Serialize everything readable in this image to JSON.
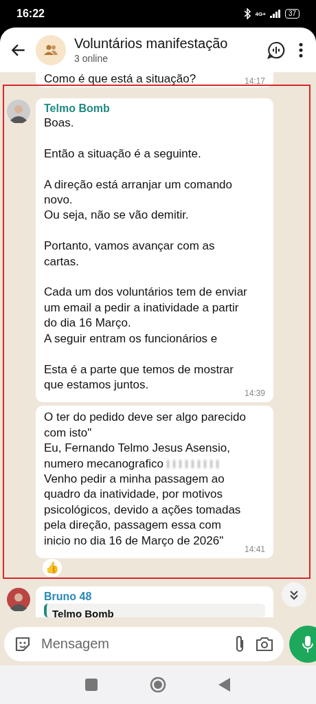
{
  "status_bar": {
    "time": "16:22",
    "network": "4G+",
    "battery": "37"
  },
  "header": {
    "title": "Voluntários manifestação",
    "subtitle": "3 online"
  },
  "messages": [
    {
      "kind": "partial",
      "text": "Como é que está a  situação?",
      "time": "14:17"
    },
    {
      "kind": "incoming",
      "sender": "Telmo Bomb",
      "segments": [
        {
          "kind": "text",
          "text": "Boas.\n\nEntão a situação é a seguinte.\n\nA direção está arranjar um comando novo.\nOu seja, não se vão demitir.\n\nPortanto, vamos avançar com as cartas.\n\nCada um dos voluntários tem de enviar um email a pedir a inatividade a partir do dia 16 Março.\nA seguir entram os funcionários e\n\nEsta é a parte que temos de mostrar que estamos juntos."
        }
      ],
      "time": "14:39"
    },
    {
      "kind": "continuation",
      "segments": [
        {
          "kind": "text",
          "text": "O ter do pedido deve ser algo parecido com isto\"\nEu, Fernando Telmo Jesus Asensio, numero mecanografico "
        },
        {
          "kind": "redacted"
        },
        {
          "kind": "text",
          "text": "\nVenho pedir a minha passagem ao quadro da inatividade, por motivos psicológicos, devido a ações tomadas pela direção, passagem essa com inicio no dia 16 de Março de 2026\""
        }
      ],
      "time": "14:41",
      "reaction": "👍"
    },
    {
      "kind": "incoming_cut",
      "sender": "Bruno 48",
      "quote_sender": "Telmo Bomb"
    }
  ],
  "composer": {
    "placeholder": "Mensagem"
  }
}
